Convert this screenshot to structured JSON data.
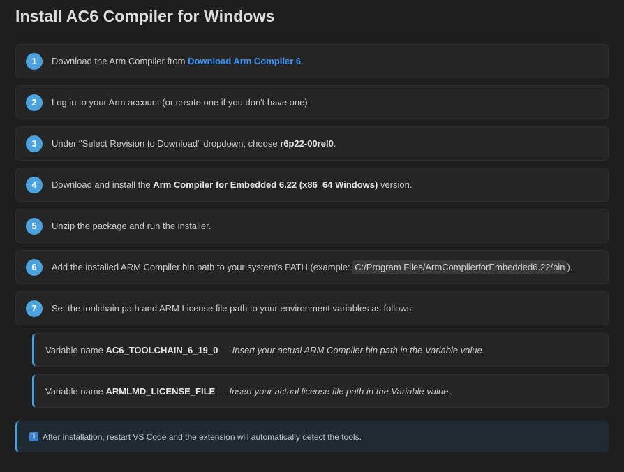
{
  "page": {
    "title": "Install AC6 Compiler for Windows"
  },
  "steps": [
    {
      "number": "1",
      "text_before": "Download the Arm Compiler from ",
      "link": "Download Arm Compiler 6",
      "text_after": "."
    },
    {
      "number": "2",
      "text": "Log in to your Arm account (or create one if you don't have one)."
    },
    {
      "number": "3",
      "text_before": "Under \"Select Revision to Download\" dropdown, choose ",
      "bold": "r6p22-00rel0",
      "text_after": "."
    },
    {
      "number": "4",
      "text_before": "Download and install the ",
      "bold": "Arm Compiler for Embedded 6.22 (x86_64 Windows)",
      "text_after": " version."
    },
    {
      "number": "5",
      "text": "Unzip the package and run the installer."
    },
    {
      "number": "6",
      "text_before": "Add the installed ARM Compiler bin path to your system's PATH (example: ",
      "code": "C:/Program Files/ArmCompilerforEmbedded6.22/bin",
      "text_after": ")."
    },
    {
      "number": "7",
      "text": "Set the toolchain path and ARM License file path to your environment variables as follows:"
    }
  ],
  "variables": [
    {
      "prefix": "Variable name ",
      "name": "AC6_TOOLCHAIN_6_19_0",
      "dash": " — ",
      "desc": "Insert your actual ARM Compiler bin path in the Variable value."
    },
    {
      "prefix": "Variable name ",
      "name": "ARMLMD_LICENSE_FILE",
      "dash": " — ",
      "desc": "Insert your actual license file path in the Variable value."
    }
  ],
  "notice": {
    "icon": "info-icon",
    "icon_glyph": "i",
    "text": "After installation, restart VS Code and the extension will automatically detect the tools."
  },
  "colors": {
    "background": "#1e1e1e",
    "card": "#252526",
    "accent": "#4aa3df",
    "link": "#3794ff",
    "notice_bg": "#1f2a33"
  }
}
